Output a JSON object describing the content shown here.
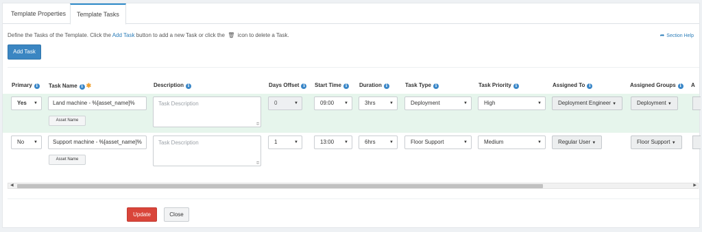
{
  "tabs": [
    {
      "label": "Template Properties"
    },
    {
      "label": "Template Tasks"
    }
  ],
  "description": {
    "part1": "Define the Tasks of the Template. Click the",
    "link": "Add Task",
    "part2": "button to add a new Task or click the",
    "part3": "icon to delete a Task."
  },
  "section_help": "Section Help",
  "add_task_label": "Add Task",
  "columns": {
    "primary": "Primary",
    "task_name": "Task Name",
    "description": "Description",
    "days_offset": "Days Offset",
    "start_time": "Start Time",
    "duration": "Duration",
    "task_type": "Task Type",
    "task_priority": "Task Priority",
    "assigned_to": "Assigned To",
    "assigned_groups": "Assigned Groups",
    "next_partial": "A"
  },
  "rows": [
    {
      "primary": "Yes",
      "task_name": "Land machine - %[asset_name]%",
      "asset_name_btn": "Asset Name",
      "description_placeholder": "Task Description",
      "days_offset": "0",
      "start_time": "09:00",
      "duration": "3hrs",
      "task_type": "Deployment",
      "task_priority": "High",
      "assigned_to": "Deployment Engineer",
      "assigned_groups": "Deployment"
    },
    {
      "primary": "No",
      "task_name": "Support machine - %[asset_name]%",
      "asset_name_btn": "Asset Name",
      "description_placeholder": "Task Description",
      "days_offset": "1",
      "start_time": "13:00",
      "duration": "6hrs",
      "task_type": "Floor Support",
      "task_priority": "Medium",
      "assigned_to": "Regular User",
      "assigned_groups": "Floor Support"
    }
  ],
  "footer": {
    "update_label": "Update",
    "close_label": "Close"
  },
  "icons": {
    "info": "i",
    "required": "✱",
    "trash": "trash-icon",
    "share": "share-icon"
  }
}
